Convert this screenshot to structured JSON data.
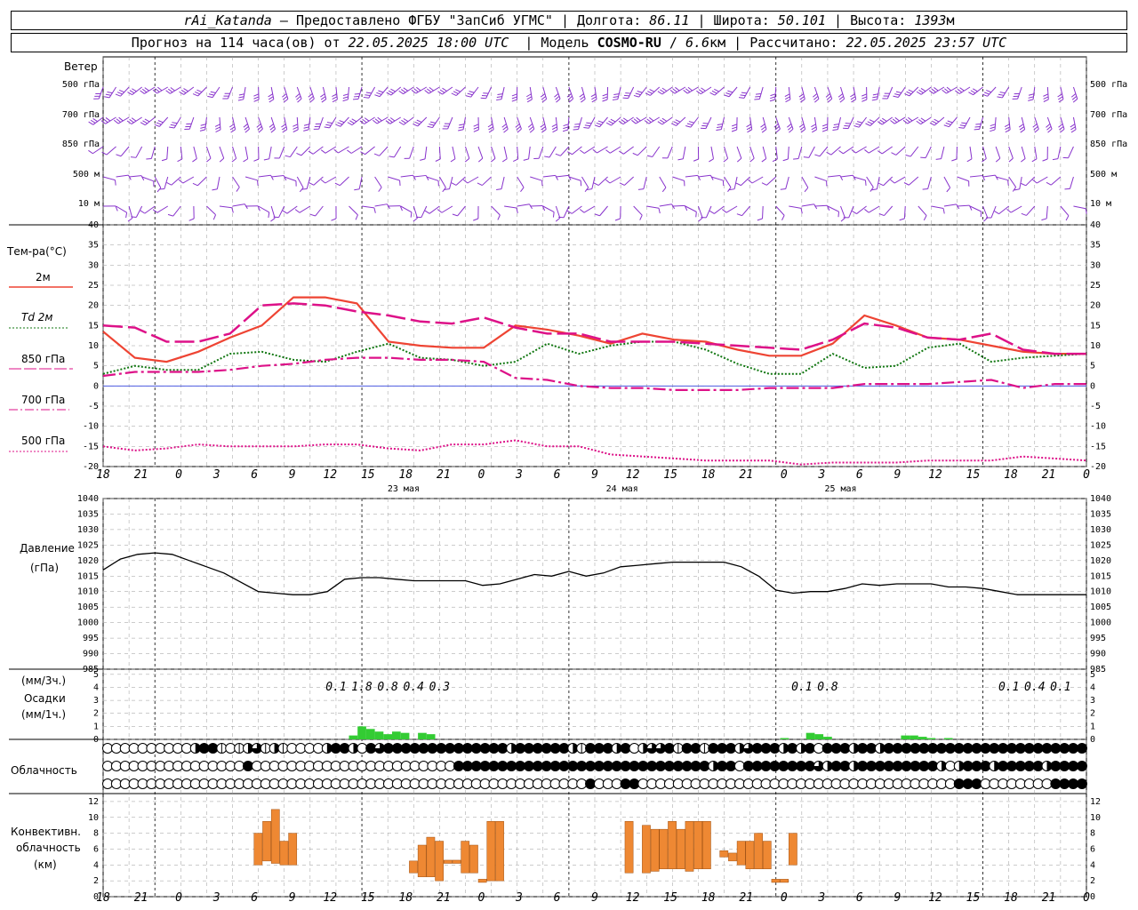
{
  "header": {
    "station": "rAi_Katanda",
    "dash": " — ",
    "provider": "Предоставлено ФГБУ \"ЗапСиб УГМС\"",
    "lon_label": "Долгота:",
    "lon": "86.11",
    "lat_label": "Широта:",
    "lat": "50.101",
    "alt_label": "Высота:",
    "alt": "1393",
    "alt_unit": "м",
    "forecast_prefix": "Прогноз на 114 часа(ов) от",
    "forecast_time": "22.05.2025 18:00 UTC",
    "model_label": "Модель",
    "model": "COSMO-RU",
    "model_res": "6.6",
    "model_res_unit": "км",
    "calc_label": "Рассчитано:",
    "calc_time": "22.05.2025 23:57 UTC"
  },
  "colors": {
    "t2m": "#ee4433",
    "td2m": "#117711",
    "t850": "#dd1188",
    "t700": "#dd1188",
    "t500": "#dd1188",
    "wind": "#8833cc",
    "precip": "#33cc33",
    "conv": "#ee8833",
    "zero": "#3344dd"
  },
  "chart_data": [
    {
      "type": "wind-barbs",
      "title": "Ветер",
      "levels": [
        "500 гПа",
        "700 гПа",
        "850 гПа",
        "500 м",
        "10 м"
      ]
    },
    {
      "type": "line",
      "ylabel": "Тем-ра(°C)",
      "ylim": [
        -20,
        40
      ],
      "yticks": [
        -20,
        -15,
        -10,
        -5,
        0,
        5,
        10,
        15,
        20,
        25,
        30,
        35,
        40
      ],
      "x_hours": [
        0,
        3,
        6,
        9,
        12,
        15,
        18,
        21,
        24,
        27,
        30,
        33,
        36,
        39,
        42,
        45,
        48,
        51,
        54,
        57,
        60,
        63,
        66,
        69,
        72,
        75,
        78,
        81,
        84,
        87,
        90,
        93,
        96,
        99,
        102,
        105,
        108,
        111,
        114
      ],
      "series": [
        {
          "name": "2м",
          "style": "solid",
          "values": [
            13.5,
            7,
            6,
            8.5,
            12,
            15,
            22,
            22,
            20.5,
            11,
            10,
            9.5,
            9.5,
            15,
            14,
            12.5,
            10.5,
            13,
            11.5,
            11,
            9,
            7.5,
            7.5,
            10.5,
            17.5,
            15,
            12,
            11.5,
            10,
            8.5,
            8,
            8
          ]
        },
        {
          "name": "Td 2м",
          "style": "dotted",
          "values": [
            3,
            5,
            4,
            4,
            8,
            8.5,
            6.5,
            6,
            8.5,
            10.5,
            7,
            6.5,
            5,
            6,
            10.5,
            8,
            10,
            11,
            11,
            9,
            5.5,
            3,
            3,
            8,
            4.5,
            5,
            9.5,
            10.5,
            6,
            7,
            7.5,
            8
          ]
        },
        {
          "name": "850 гПа",
          "style": "long-dash",
          "values": [
            15,
            14.5,
            11,
            11,
            13,
            20,
            20.5,
            20,
            18.5,
            17.5,
            16,
            15.5,
            17,
            14.5,
            13,
            13,
            11,
            11,
            11,
            10.5,
            10,
            9.5,
            9,
            11.5,
            15.5,
            14.5,
            12,
            11.5,
            13,
            9,
            8,
            8
          ]
        },
        {
          "name": "700 гПа",
          "style": "dash-dot",
          "values": [
            2.5,
            3.5,
            3.5,
            3.5,
            4,
            5,
            5.5,
            6.5,
            7,
            7,
            6.5,
            6.5,
            6,
            2,
            1.5,
            0,
            -0.5,
            -0.5,
            -1,
            -1,
            -1,
            -0.5,
            -0.5,
            -0.5,
            0.5,
            0.5,
            0.5,
            1,
            1.5,
            -0.5,
            0.5,
            0.5
          ]
        },
        {
          "name": "500 гПа",
          "style": "dotted",
          "values": [
            -15,
            -16,
            -15.5,
            -14.5,
            -15,
            -15,
            -15,
            -14.5,
            -14.5,
            -15.5,
            -16,
            -14.5,
            -14.5,
            -13.5,
            -15,
            -15,
            -17,
            -17.5,
            -18,
            -18.5,
            -18.5,
            -18.5,
            -19.5,
            -19,
            -19,
            -19,
            -18.5,
            -18.5,
            -18.5,
            -17.5,
            -18,
            -18.5
          ]
        }
      ],
      "x_points": [
        0,
        3,
        6,
        9,
        12,
        15,
        18,
        21,
        24,
        27,
        30,
        33,
        36,
        39,
        42,
        45,
        48,
        51,
        54,
        57,
        60,
        63,
        66,
        69,
        72,
        75,
        78,
        81,
        84,
        87,
        90,
        93
      ]
    },
    {
      "type": "line",
      "ylabel": "Давление",
      "ylabel2": "(гПа)",
      "ylim": [
        985,
        1040
      ],
      "yticks": [
        985,
        990,
        995,
        1000,
        1005,
        1010,
        1015,
        1020,
        1025,
        1030,
        1035,
        1040
      ],
      "x_hours": [
        0,
        2,
        4,
        6,
        8,
        10,
        12,
        14,
        16,
        18,
        20,
        22,
        24,
        26,
        28,
        30,
        32,
        34,
        36,
        38,
        40,
        42,
        44,
        46,
        48,
        50,
        52,
        54,
        56,
        58,
        60,
        62,
        64,
        66,
        68,
        70,
        72,
        74,
        76,
        78,
        80,
        82,
        84,
        86,
        88,
        90,
        92,
        94,
        96,
        98,
        100,
        102,
        104,
        106,
        108,
        110,
        112,
        114
      ],
      "values": [
        1017,
        1020.5,
        1022,
        1022.5,
        1022,
        1020,
        1018,
        1016,
        1013,
        1010,
        1009.5,
        1009,
        1009,
        1010,
        1014,
        1014.5,
        1014.5,
        1014,
        1013.5,
        1013.5,
        1013.5,
        1013.5,
        1012,
        1012.5,
        1014,
        1015.5,
        1015,
        1016.5,
        1015,
        1016,
        1018,
        1018.5,
        1019,
        1019.5,
        1019.5,
        1019.5,
        1019.5,
        1018,
        1015,
        1010.5,
        1009.5,
        1010,
        1010,
        1011,
        1012.5,
        1012,
        1012.5,
        1012.5,
        1012.5,
        1011.5,
        1011.5,
        1011,
        1010,
        1009,
        1009,
        1009,
        1009,
        1009
      ]
    },
    {
      "type": "bar",
      "ylabel": "(мм/3ч.)",
      "ylabel2": "Осадки",
      "ylabel3": "(мм/1ч.)",
      "ylim": [
        0,
        5
      ],
      "yticks": [
        0,
        1,
        2,
        3,
        4,
        5
      ],
      "totals": [
        {
          "x": 27,
          "label": "0.1"
        },
        {
          "x": 30,
          "label": "1.8"
        },
        {
          "x": 33,
          "label": "0.8"
        },
        {
          "x": 36,
          "label": "0.4"
        },
        {
          "x": 39,
          "label": "0.3"
        },
        {
          "x": 81,
          "label": "0.1"
        },
        {
          "x": 84,
          "label": "0.8"
        },
        {
          "x": 105,
          "label": "0.1"
        },
        {
          "x": 108,
          "label": "0.4"
        },
        {
          "x": 111,
          "label": "0.1"
        }
      ],
      "bars": [
        {
          "x": 29,
          "v": 0.3
        },
        {
          "x": 30,
          "v": 1.0
        },
        {
          "x": 31,
          "v": 0.8
        },
        {
          "x": 32,
          "v": 0.6
        },
        {
          "x": 33,
          "v": 0.4
        },
        {
          "x": 34,
          "v": 0.6
        },
        {
          "x": 35,
          "v": 0.5
        },
        {
          "x": 37,
          "v": 0.5
        },
        {
          "x": 38,
          "v": 0.4
        },
        {
          "x": 79,
          "v": 0.1
        },
        {
          "x": 82,
          "v": 0.5
        },
        {
          "x": 83,
          "v": 0.4
        },
        {
          "x": 84,
          "v": 0.2
        },
        {
          "x": 93,
          "v": 0.3
        },
        {
          "x": 94,
          "v": 0.3
        },
        {
          "x": 95,
          "v": 0.2
        },
        {
          "x": 96,
          "v": 0.1
        },
        {
          "x": 98,
          "v": 0.1
        }
      ]
    },
    {
      "type": "table",
      "ylabel": "Облачность",
      "rows": [
        "0000000000244101231210000244204344444444444444244444421444240233414414442344424240444244244444444444444444444444",
        "0000000000000000400000000000000000000000444444444444444444444444444442440444444443244244444444420244424444424444",
        "0000000000000000000000000000000000000000000000000000000400044000000000000000000000000000000000000444000000004444"
      ]
    },
    {
      "type": "bar",
      "ylabel": "Конвективн.",
      "ylabel2": "облачность",
      "ylabel3": "(км)",
      "ylim": [
        0,
        13
      ],
      "yticks": [
        0,
        2,
        4,
        6,
        8,
        10,
        12
      ],
      "bars": [
        {
          "x": 18,
          "lo": 4,
          "hi": 8
        },
        {
          "x": 19,
          "lo": 4.5,
          "hi": 9.5
        },
        {
          "x": 20,
          "lo": 4.2,
          "hi": 11
        },
        {
          "x": 21,
          "lo": 4,
          "hi": 7
        },
        {
          "x": 22,
          "lo": 4,
          "hi": 8
        },
        {
          "x": 36,
          "lo": 3,
          "hi": 4.5
        },
        {
          "x": 37,
          "lo": 2.5,
          "hi": 6.5
        },
        {
          "x": 38,
          "lo": 2.5,
          "hi": 7.5
        },
        {
          "x": 39,
          "lo": 2,
          "hi": 7
        },
        {
          "x": 40,
          "lo": 4.2,
          "hi": 4.6
        },
        {
          "x": 41,
          "lo": 4.2,
          "hi": 4.6
        },
        {
          "x": 42,
          "lo": 3,
          "hi": 7
        },
        {
          "x": 43,
          "lo": 3,
          "hi": 6.5
        },
        {
          "x": 44,
          "lo": 1.8,
          "hi": 2.2
        },
        {
          "x": 45,
          "lo": 2,
          "hi": 9.5
        },
        {
          "x": 46,
          "lo": 2,
          "hi": 9.5
        },
        {
          "x": 61,
          "lo": 3,
          "hi": 9.5
        },
        {
          "x": 63,
          "lo": 3,
          "hi": 9
        },
        {
          "x": 64,
          "lo": 3.2,
          "hi": 8.5
        },
        {
          "x": 65,
          "lo": 3.5,
          "hi": 8.5
        },
        {
          "x": 66,
          "lo": 3.5,
          "hi": 9.5
        },
        {
          "x": 67,
          "lo": 3.5,
          "hi": 8.5
        },
        {
          "x": 68,
          "lo": 3.2,
          "hi": 9.5
        },
        {
          "x": 69,
          "lo": 3.5,
          "hi": 9.5
        },
        {
          "x": 70,
          "lo": 3.5,
          "hi": 9.5
        },
        {
          "x": 72,
          "lo": 5,
          "hi": 5.8
        },
        {
          "x": 73,
          "lo": 4.5,
          "hi": 5.5
        },
        {
          "x": 74,
          "lo": 4,
          "hi": 7
        },
        {
          "x": 75,
          "lo": 3.5,
          "hi": 7
        },
        {
          "x": 76,
          "lo": 3.5,
          "hi": 8
        },
        {
          "x": 77,
          "lo": 3.5,
          "hi": 7
        },
        {
          "x": 78,
          "lo": 1.8,
          "hi": 2.2
        },
        {
          "x": 79,
          "lo": 1.8,
          "hi": 2.2
        },
        {
          "x": 80,
          "lo": 4,
          "hi": 8
        }
      ]
    }
  ],
  "xaxis": {
    "hour_labels": [
      "18",
      "21",
      "0",
      "3",
      "6",
      "9",
      "12",
      "15",
      "18",
      "21",
      "0",
      "3",
      "6",
      "9",
      "12",
      "15",
      "18",
      "21",
      "0",
      "3",
      "6",
      "9",
      "12",
      "15",
      "18",
      "21",
      "0"
    ],
    "day_labels": [
      "23 мая",
      "24 мая",
      "25 мая"
    ]
  }
}
